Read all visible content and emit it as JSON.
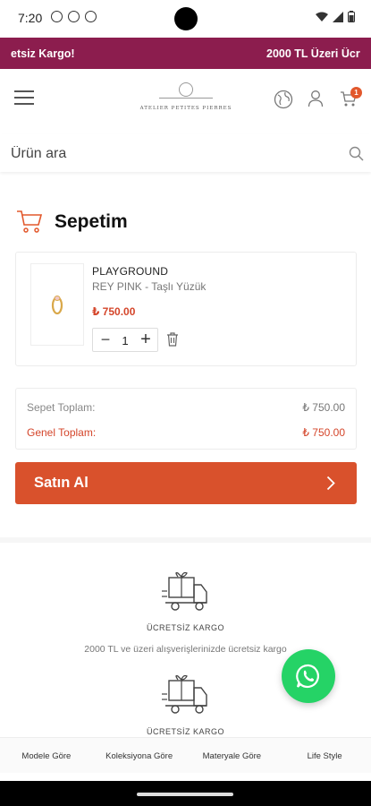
{
  "status_bar": {
    "time": "7:20"
  },
  "promo": {
    "left_text": "etsiz Kargo!",
    "right_text": "2000 TL Üzeri Ücr"
  },
  "header": {
    "logo_text": "ATELIER PETITES PIERRES",
    "cart_count": "1"
  },
  "search": {
    "placeholder": "Ürün ara"
  },
  "cart": {
    "title": "Sepetim",
    "items": [
      {
        "brand": "PLAYGROUND",
        "name": "REY PINK - Taşlı Yüzük",
        "price": "₺ 750.00",
        "quantity": "1"
      }
    ]
  },
  "totals": {
    "subtotal_label": "Sepet Toplam:",
    "subtotal_value": "₺ 750.00",
    "total_label": "Genel Toplam:",
    "total_value": "₺ 750.00"
  },
  "buy_button": {
    "label": "Satın Al"
  },
  "shipping_info": [
    {
      "title": "ÜCRETSİZ KARGO",
      "description": "2000 TL ve üzeri alışverişlerinizde ücretsiz kargo"
    },
    {
      "title": "ÜCRETSİZ KARGO"
    }
  ],
  "bottom_nav": [
    "Modele Göre",
    "Koleksiyona Göre",
    "Materyale Göre",
    "Life Style"
  ],
  "colors": {
    "promo_bar": "#8c1d4e",
    "accent": "#d9512c",
    "price": "#d4452a",
    "whatsapp": "#25d366"
  }
}
